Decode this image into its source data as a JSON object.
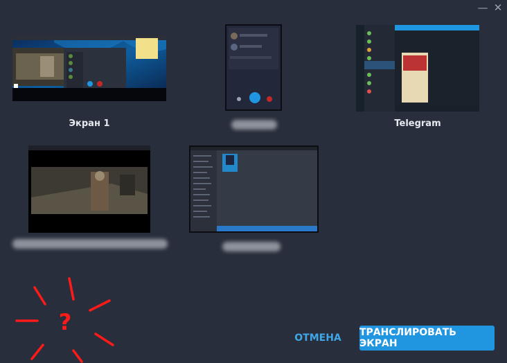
{
  "window": {
    "minimize_symbol": "—",
    "close_symbol": "✕"
  },
  "sources": [
    {
      "label": "Экран 1",
      "kind": "screen",
      "thumbnail": "desktop-screen"
    },
    {
      "label": "",
      "kind": "window",
      "thumbnail": "call-window",
      "label_obscured": true
    },
    {
      "label": "Telegram",
      "kind": "window",
      "thumbnail": "telegram-chat"
    },
    {
      "label": "",
      "kind": "window",
      "thumbnail": "video-player",
      "label_obscured": true
    },
    {
      "label": "",
      "kind": "window",
      "thumbnail": "file-manager",
      "label_obscured": true
    }
  ],
  "actions": {
    "cancel_label": "ОТМЕНА",
    "share_label": "ТРАНСЛИРОВАТЬ ЭКРАН"
  },
  "annotation": {
    "text": "?",
    "color": "#ff1a1a"
  },
  "colors": {
    "background": "#282e3b",
    "accent": "#2196e0",
    "cancel_text": "#3fa7e6"
  }
}
